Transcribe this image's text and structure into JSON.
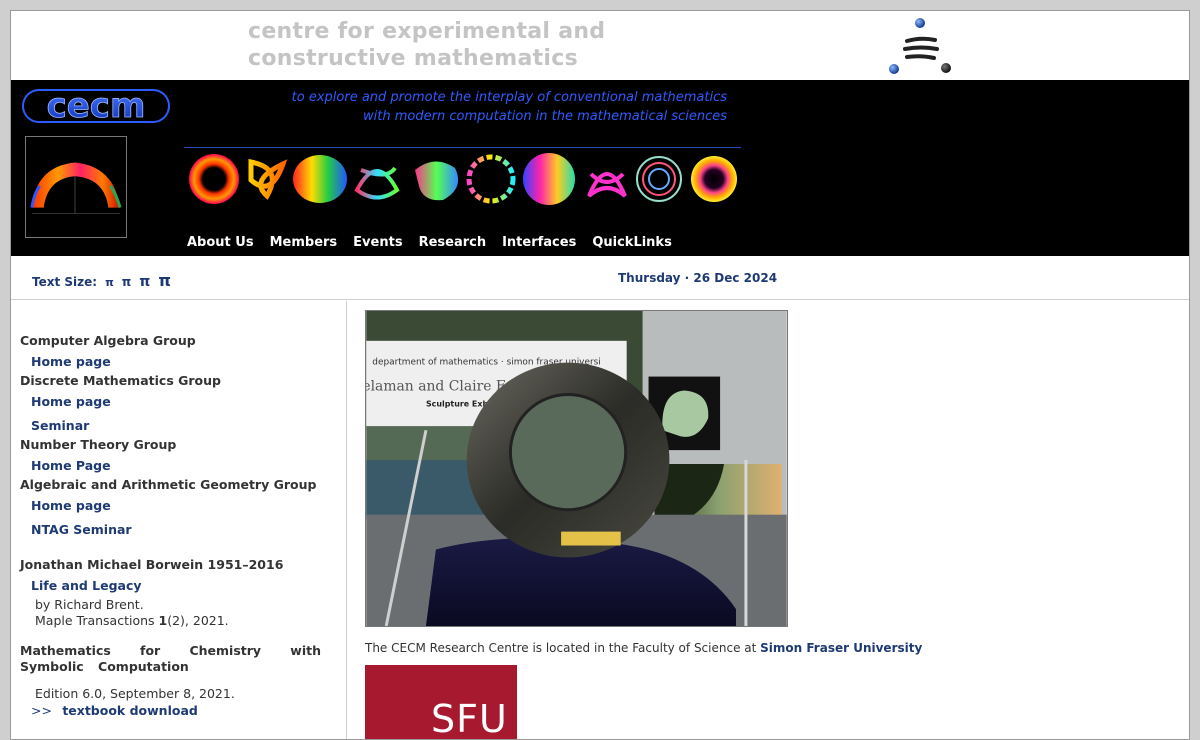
{
  "banner": {
    "title_line1": "centre for experimental and",
    "title_line2": "constructive mathematics"
  },
  "header": {
    "logo_text": "cecm",
    "tagline_line1": "to explore and promote the interplay of conventional mathematics",
    "tagline_line2": "with modern computation in the mathematical sciences",
    "nav": [
      "About Us",
      "Members",
      "Events",
      "Research",
      "Interfaces",
      "QuickLinks"
    ]
  },
  "util": {
    "text_size_label": "Text Size:",
    "text_size_options": [
      "π",
      "π",
      "π",
      "π"
    ],
    "date": "Thursday · 26 Dec 2024"
  },
  "sidebar": {
    "computer_algebra": {
      "title": "Computer Algebra Group",
      "link": "Home page"
    },
    "discrete_math": {
      "title": "Discrete Mathematics Group",
      "link1": "Home page",
      "link2": "Seminar"
    },
    "number_theory": {
      "title": "Number Theory Group",
      "link": "Home Page"
    },
    "arith_geom": {
      "title": "Algebraic and Arithmetic Geometry Group",
      "link1": "Home page",
      "link2": "NTAG Seminar"
    },
    "borwein": {
      "title": "Jonathan Michael Borwein 1951–2016",
      "link": "Life and Legacy",
      "note1": "by Richard Brent.",
      "note2_pre": "Maple Transactions ",
      "note2_bold": "1",
      "note2_post": "(2), 2021."
    },
    "chem": {
      "title": "Mathematics for Chemistry with Symbolic Computation",
      "edition": "Edition 6.0, September 8, 2021.",
      "arrow": ">>",
      "download": "textbook download"
    }
  },
  "main": {
    "caption_prefix": "The CECM Research Centre is located in the Faculty of Science at ",
    "caption_link": "Simon Fraser University",
    "sfu_logo_text": "SFU",
    "photo_banner_line1": "department of mathematics · simon fraser universi",
    "photo_banner_line2": "elaman and Claire F",
    "photo_banner_line3": "Sculpture Exhibitio"
  },
  "colors": {
    "nav_link": "#1e3a75",
    "tagline": "#2f5bff",
    "sfu_red": "#a6192e",
    "banner_title": "#c4c4c4"
  }
}
